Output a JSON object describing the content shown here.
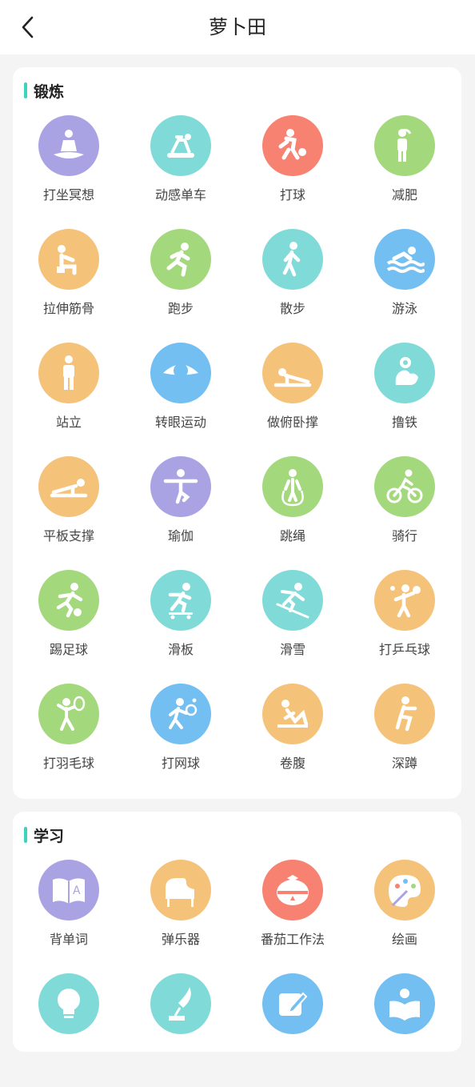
{
  "header": {
    "title": "萝卜田"
  },
  "sections": {
    "exercise": {
      "title": "锻炼",
      "items": [
        {
          "label": "打坐冥想",
          "icon": "meditation-icon",
          "color": "#a9a3e3"
        },
        {
          "label": "动感单车",
          "icon": "spin-bike-icon",
          "color": "#80dbd8"
        },
        {
          "label": "打球",
          "icon": "basketball-player-icon",
          "color": "#f78271"
        },
        {
          "label": "减肥",
          "icon": "slim-person-icon",
          "color": "#a4d87c"
        },
        {
          "label": "拉伸筋骨",
          "icon": "stretch-icon",
          "color": "#f5c27a"
        },
        {
          "label": "跑步",
          "icon": "running-icon",
          "color": "#a4d87c"
        },
        {
          "label": "散步",
          "icon": "walking-icon",
          "color": "#80dbd8"
        },
        {
          "label": "游泳",
          "icon": "swimming-icon",
          "color": "#73bff2"
        },
        {
          "label": "站立",
          "icon": "standing-icon",
          "color": "#f5c27a"
        },
        {
          "label": "转眼运动",
          "icon": "eye-icon",
          "color": "#73bff2"
        },
        {
          "label": "做俯卧撑",
          "icon": "pushup-icon",
          "color": "#f5c27a"
        },
        {
          "label": "撸铁",
          "icon": "dumbbell-arm-icon",
          "color": "#80dbd8"
        },
        {
          "label": "平板支撑",
          "icon": "plank-icon",
          "color": "#f5c27a"
        },
        {
          "label": "瑜伽",
          "icon": "yoga-icon",
          "color": "#a9a3e3"
        },
        {
          "label": "跳绳",
          "icon": "jump-rope-icon",
          "color": "#a4d87c"
        },
        {
          "label": "骑行",
          "icon": "cycling-icon",
          "color": "#a4d87c"
        },
        {
          "label": "踢足球",
          "icon": "soccer-icon",
          "color": "#a4d87c"
        },
        {
          "label": "滑板",
          "icon": "skateboard-icon",
          "color": "#80dbd8"
        },
        {
          "label": "滑雪",
          "icon": "skiing-icon",
          "color": "#80dbd8"
        },
        {
          "label": "打乒乓球",
          "icon": "table-tennis-icon",
          "color": "#f5c27a"
        },
        {
          "label": "打羽毛球",
          "icon": "badminton-icon",
          "color": "#a4d87c"
        },
        {
          "label": "打网球",
          "icon": "tennis-icon",
          "color": "#73bff2"
        },
        {
          "label": "卷腹",
          "icon": "situp-icon",
          "color": "#f5c27a"
        },
        {
          "label": "深蹲",
          "icon": "squat-icon",
          "color": "#f5c27a"
        }
      ]
    },
    "study": {
      "title": "学习",
      "items": [
        {
          "label": "背单词",
          "icon": "book-letter-icon",
          "color": "#a9a3e3"
        },
        {
          "label": "弹乐器",
          "icon": "piano-icon",
          "color": "#f5c27a"
        },
        {
          "label": "番茄工作法",
          "icon": "tomato-timer-icon",
          "color": "#f78271"
        },
        {
          "label": "绘画",
          "icon": "palette-icon",
          "color": "#f5c27a"
        },
        {
          "label": "",
          "icon": "lightbulb-icon",
          "color": "#80dbd8"
        },
        {
          "label": "",
          "icon": "quill-pen-icon",
          "color": "#80dbd8"
        },
        {
          "label": "",
          "icon": "edit-note-icon",
          "color": "#73bff2"
        },
        {
          "label": "",
          "icon": "reading-icon",
          "color": "#73bff2"
        }
      ]
    }
  }
}
